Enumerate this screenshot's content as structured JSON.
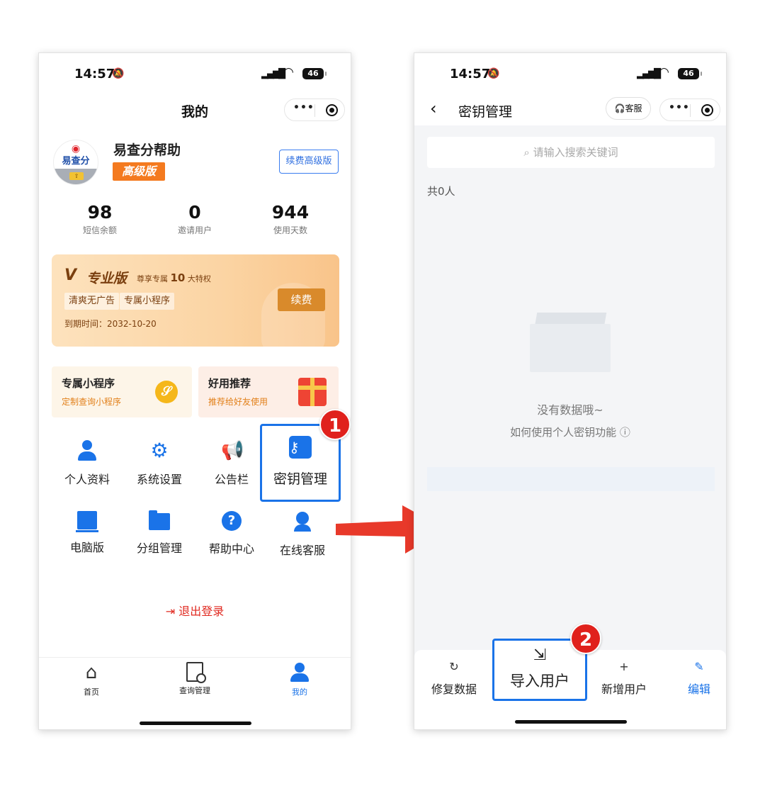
{
  "status_bar": {
    "time": "14:57",
    "battery": "46"
  },
  "me_page": {
    "title": "我的",
    "user": {
      "name": "易查分帮助",
      "badge": "高级版",
      "logo_text": "易查分",
      "renew_button": "续费高级版"
    },
    "stats": [
      {
        "value": "98",
        "label": "短信余额"
      },
      {
        "value": "0",
        "label": "邀请用户"
      },
      {
        "value": "944",
        "label": "使用天数"
      }
    ],
    "vip_card": {
      "vip_mark": "V",
      "edition": "专业版",
      "subtitle_prefix": "尊享专属",
      "subtitle_num": "10",
      "subtitle_suffix": "大特权",
      "tags": [
        "清爽无广告",
        "专属小程序"
      ],
      "expiry": "到期时间：2032-10-20",
      "renew_button": "续费"
    },
    "promos": [
      {
        "title": "专属小程序",
        "subtitle": "定制查询小程序"
      },
      {
        "title": "好用推荐",
        "subtitle": "推荐给好友使用"
      }
    ],
    "menu_row1": [
      "个人资料",
      "系统设置",
      "公告栏",
      "密钥管理"
    ],
    "menu_row2": [
      "电脑版",
      "分组管理",
      "帮助中心",
      "在线客服"
    ],
    "logout": "退出登录",
    "tabs": [
      "首页",
      "查询管理",
      "我的"
    ]
  },
  "key_page": {
    "title": "密钥管理",
    "service_button": "客服",
    "search_placeholder": "请输入搜索关键词",
    "count": "共0人",
    "empty_text": "没有数据哦~",
    "howto": "如何使用个人密钥功能",
    "bottom_actions": [
      "修复数据",
      "导入用户",
      "新增用户",
      "编辑"
    ]
  },
  "steps": [
    "1",
    "2"
  ],
  "colors": {
    "accent_blue": "#1a73e8",
    "step_red": "#e0211c",
    "logout_red": "#e0281f",
    "arrow_red": "#e8392a"
  }
}
